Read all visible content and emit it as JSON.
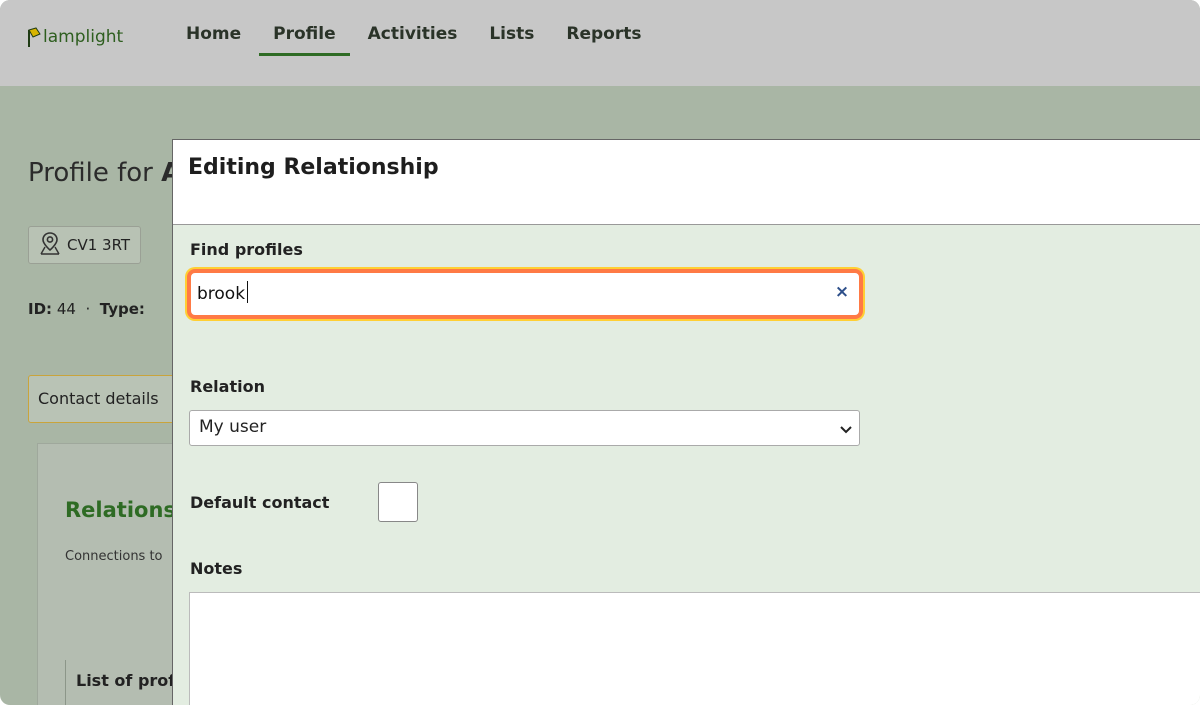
{
  "app": {
    "logo_text": "lamplight"
  },
  "nav": {
    "items": [
      {
        "label": "Home",
        "active": false
      },
      {
        "label": "Profile",
        "active": true
      },
      {
        "label": "Activities",
        "active": false
      },
      {
        "label": "Lists",
        "active": false
      },
      {
        "label": "Reports",
        "active": false
      }
    ]
  },
  "background_page": {
    "title_prefix": "Profile for",
    "title_name_fragment": "A",
    "postcode": "CV1 3RT",
    "id_label": "ID:",
    "id_value": "44",
    "separator": "·",
    "type_label": "Type:",
    "tab_contact_details": "Contact details",
    "relations_heading_fragment": "Relations",
    "relations_subtitle_fragment": "Connections to",
    "list_label_fragment": "List of prof"
  },
  "modal": {
    "title": "Editing Relationship",
    "find_profiles_label": "Find profiles",
    "search_value": "brook",
    "clear_symbol": "×",
    "relation_label": "Relation",
    "relation_selected": "My user",
    "default_contact_label": "Default contact",
    "default_contact_checked": false,
    "notes_label": "Notes",
    "notes_value": ""
  },
  "colors": {
    "accent_green": "#2e6b24",
    "search_highlight": "#ff7a45",
    "modal_bg": "#e3ede1",
    "overlay_bg": "#a9b6a5"
  }
}
